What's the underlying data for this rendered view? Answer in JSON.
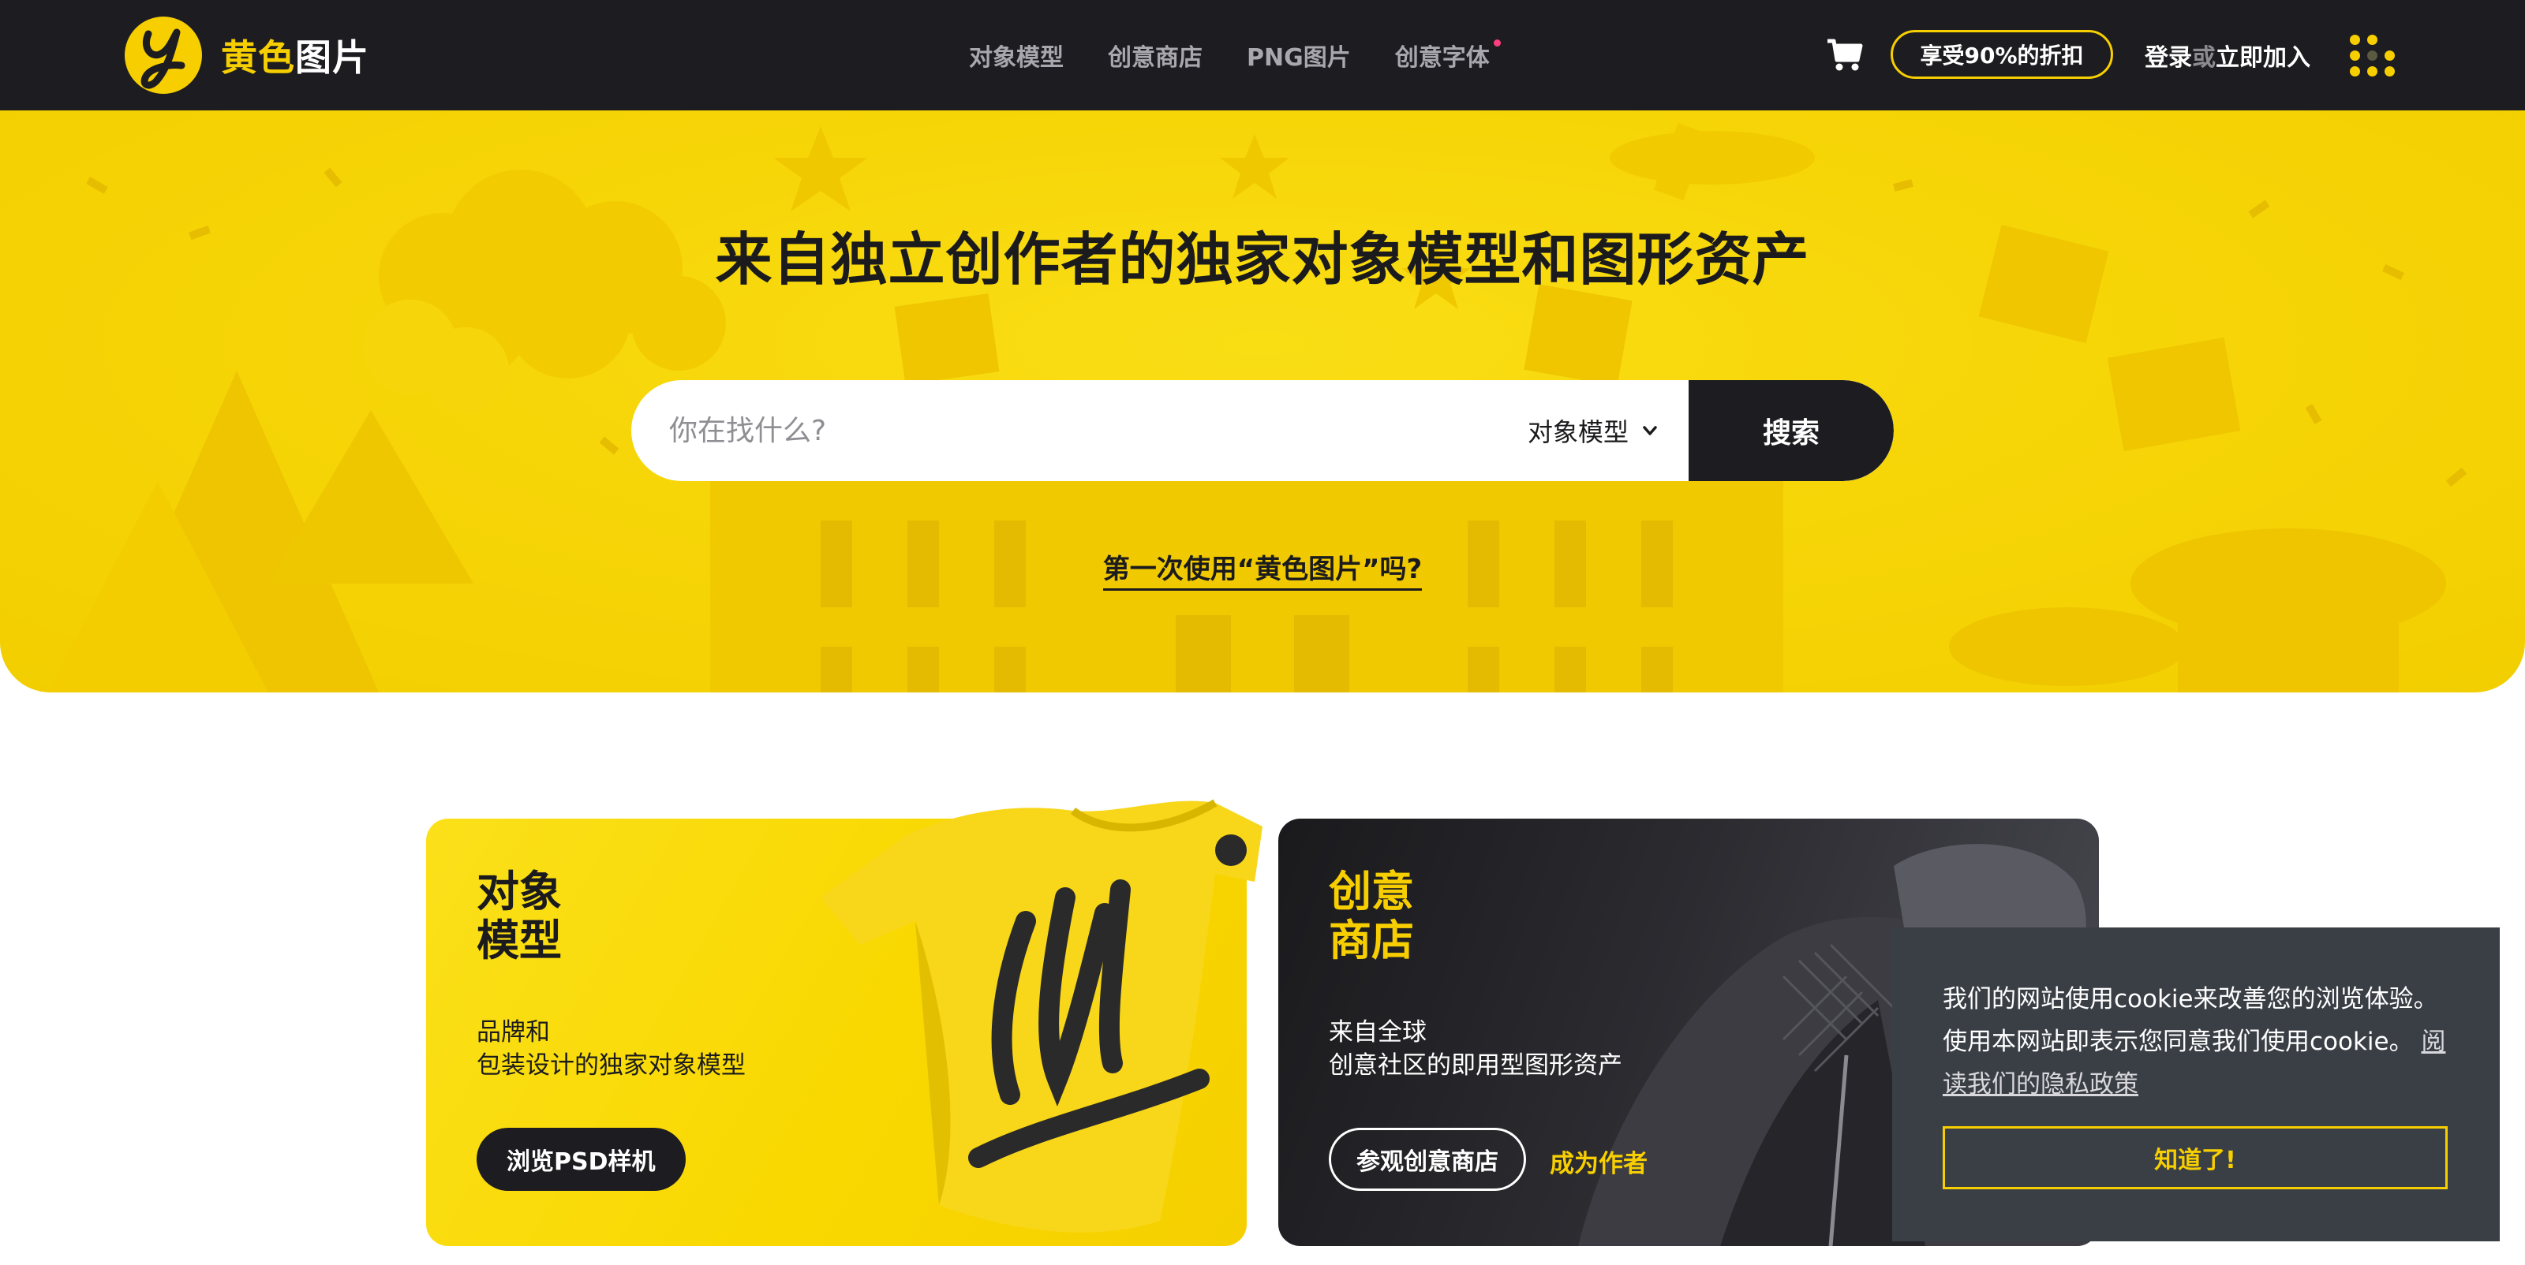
{
  "brand": {
    "name_yellow": "黄色",
    "name_white": "图片",
    "color": "#f7cf00"
  },
  "nav": {
    "links": [
      {
        "label": "对象模型"
      },
      {
        "label": "创意商店"
      },
      {
        "label": "PNG图片"
      },
      {
        "label": "创意字体",
        "new_dot": true
      }
    ],
    "promo_label": "享受90%的折扣",
    "login_label": "登录",
    "or_label": "或",
    "join_label": "立即加入",
    "cart_icon": "cart-icon",
    "menu_icon": "dots-grid-icon"
  },
  "hero": {
    "title": "来自独立创作者的独家对象模型和图形资产",
    "search": {
      "placeholder": "你在找什么?",
      "category": "对象模型",
      "button_label": "搜索"
    },
    "first_time_link": "第一次使用“黄色图片”吗?"
  },
  "cards": [
    {
      "title_line1": "对象",
      "title_line2": "模型",
      "desc_line1": "品牌和",
      "desc_line2": "包装设计的独家对象模型",
      "button_label": "浏览PSD样机"
    },
    {
      "title_line1": "创意",
      "title_line2": "商店",
      "desc_line1": "来自全球",
      "desc_line2": "创意社区的即用型图形资产",
      "button_label": "参观创意商店",
      "secondary_link": "成为作者"
    }
  ],
  "cookie": {
    "text": "我们的网站使用cookie来改善您的浏览体验。使用本网站即表示您同意我们使用cookie。",
    "link_label": "阅读我们的隐私政策",
    "button_label": "知道了!"
  },
  "colors": {
    "nav_bg": "#1d1d21",
    "accent": "#f7cf00",
    "cookie_bg": "#3a3f46",
    "new_dot": "#ff3d7f"
  }
}
